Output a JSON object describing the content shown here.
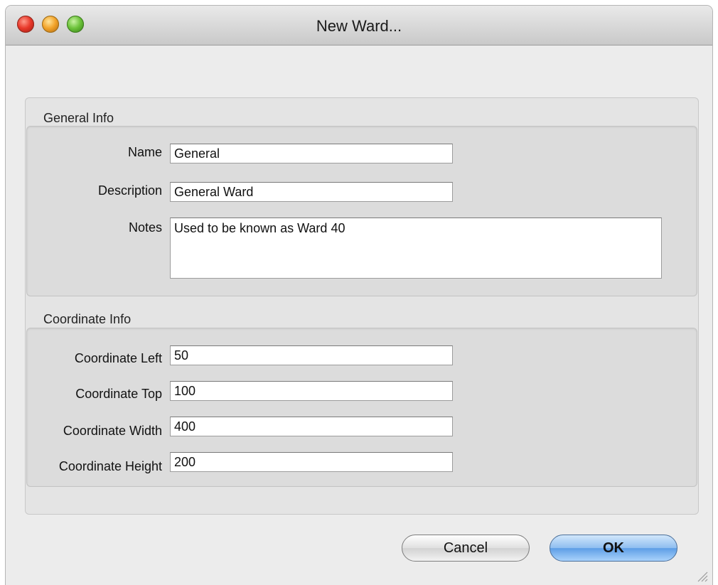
{
  "window": {
    "title": "New Ward..."
  },
  "general_info": {
    "label": "General Info",
    "name_label": "Name",
    "name_value": "General",
    "description_label": "Description",
    "description_value": "General Ward",
    "notes_label": "Notes",
    "notes_value": "Used to be known as Ward 40"
  },
  "coordinate_info": {
    "label": "Coordinate Info",
    "left_label": "Coordinate Left",
    "left_value": "50",
    "top_label": "Coordinate Top",
    "top_value": "100",
    "width_label": "Coordinate Width",
    "width_value": "400",
    "height_label": "Coordinate Height",
    "height_value": "200"
  },
  "buttons": {
    "cancel_label": "Cancel",
    "ok_label": "OK"
  },
  "colors": {
    "ok_button": "#5d9ee6",
    "window_background": "#ececec"
  }
}
